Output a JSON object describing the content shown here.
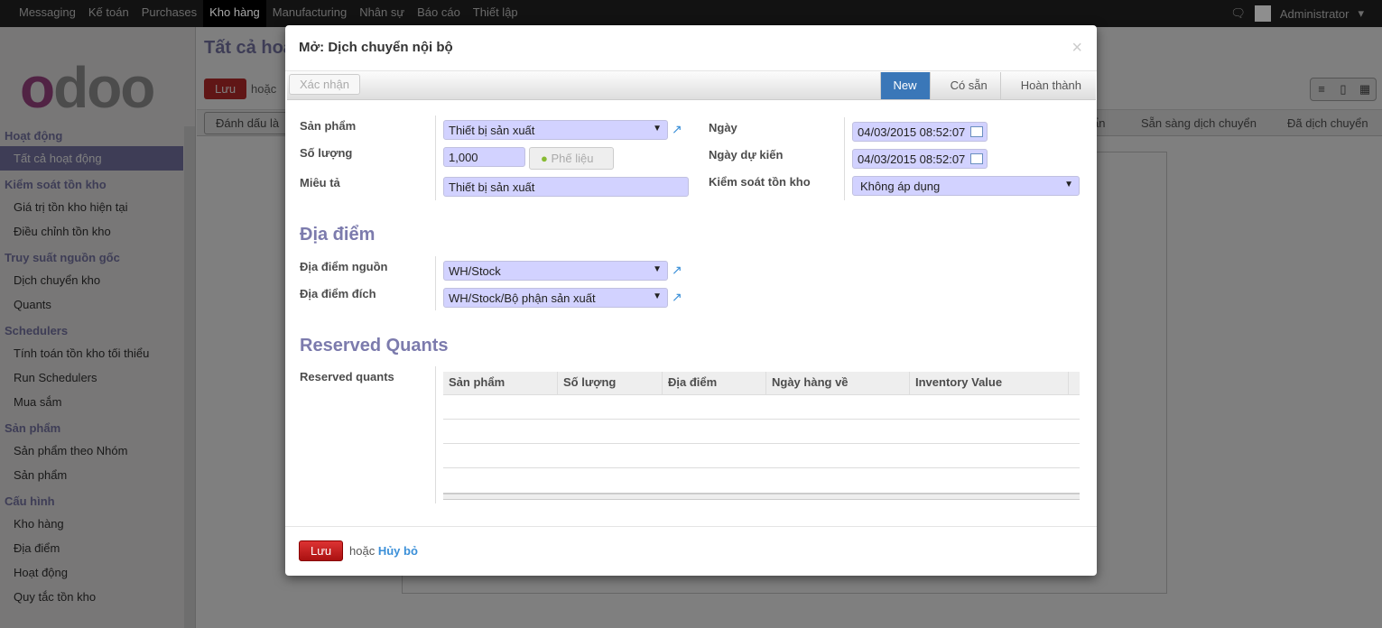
{
  "topbar": {
    "menus": [
      "Messaging",
      "Kế toán",
      "Purchases",
      "Kho hàng",
      "Manufacturing",
      "Nhân sự",
      "Báo cáo",
      "Thiết lập"
    ],
    "active": "Kho hàng",
    "user": "Administrator"
  },
  "sidebar": {
    "logo": "odoo",
    "sections": [
      {
        "title": "Hoạt động",
        "items": [
          "Tất cả hoạt động"
        ]
      },
      {
        "title": "Kiểm soát tồn kho",
        "items": [
          "Giá trị tồn kho hiện tại",
          "Điều chỉnh tồn kho"
        ]
      },
      {
        "title": "Truy suất nguồn gốc",
        "items": [
          "Dịch chuyển kho",
          "Quants"
        ]
      },
      {
        "title": "Schedulers",
        "items": [
          "Tính toán tồn kho tối thiểu",
          "Run Schedulers",
          "Mua sắm"
        ]
      },
      {
        "title": "Sản phẩm",
        "items": [
          "Sản phẩm theo Nhóm",
          "Sản phẩm"
        ]
      },
      {
        "title": "Cấu hình",
        "items": [
          "Kho hàng",
          "Địa điểm",
          "Hoạt động",
          "Quy tắc tồn kho"
        ]
      }
    ],
    "active_item": "Tất cả hoạt động"
  },
  "main": {
    "title": "Tất cả hoạt",
    "save": "Lưu",
    "or": "hoặc",
    "mark_button": "Đánh dấu là",
    "statuses": [
      "ẩn",
      "Sẵn sàng dịch chuyển",
      "Đã dịch chuyển"
    ]
  },
  "modal": {
    "title": "Mở: Dịch chuyển nội bộ",
    "confirm": "Xác nhận",
    "steps": [
      "New",
      "Có sẵn",
      "Hoàn thành"
    ],
    "current_step": "New",
    "fields": {
      "product_label": "Sản phẩm",
      "product": "Thiết bị sản xuất",
      "qty_label": "Số lượng",
      "qty": "1,000",
      "scrap": "Phế liệu",
      "desc_label": "Miêu tả",
      "desc": "Thiết bị sản xuất",
      "date_label": "Ngày",
      "date": "04/03/2015 08:52:07",
      "exp_label": "Ngày dự kiến",
      "exp": "04/03/2015 08:52:07",
      "ctrl_label": "Kiểm soát tồn kho",
      "ctrl": "Không áp dụng"
    },
    "loc_section": "Địa điểm",
    "src_label": "Địa điểm nguồn",
    "src": "WH/Stock",
    "dst_label": "Địa điểm đích",
    "dst": "WH/Stock/Bộ phận sản xuất",
    "rq_section": "Reserved Quants",
    "rq_label": "Reserved quants",
    "columns": [
      "Sản phẩm",
      "Số lượng",
      "Địa điểm",
      "Ngày hàng về",
      "Inventory Value"
    ],
    "save": "Lưu",
    "or": "hoặc",
    "cancel": "Hủy bỏ"
  },
  "colors": {
    "accent": "#7c7bad",
    "primary": "#3a77b8",
    "danger": "#c02c2c",
    "field": "#d2d2ff"
  }
}
